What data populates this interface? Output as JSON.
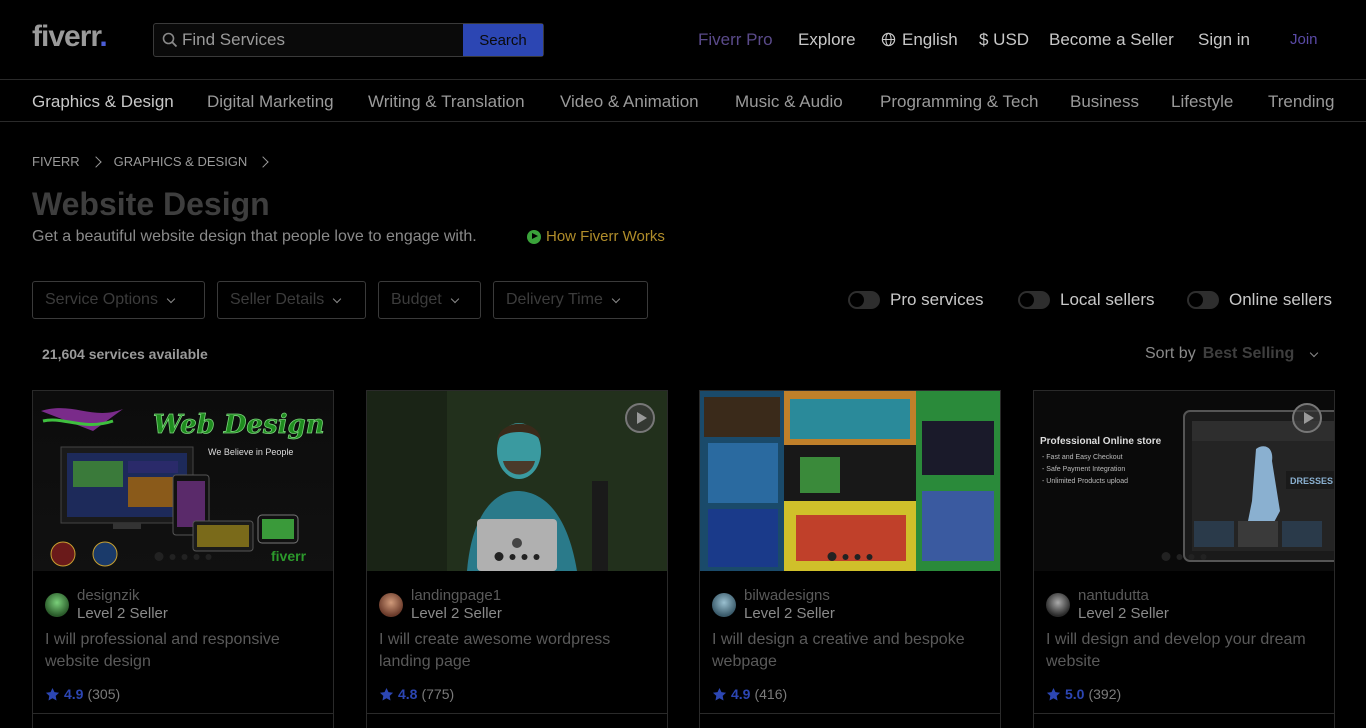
{
  "header": {
    "logo_text": "fiverr",
    "logo_dot": ".",
    "search_placeholder": "Find Services",
    "search_button": "Search",
    "nav": {
      "pro": "Fiverr Pro",
      "explore": "Explore",
      "language": "English",
      "currency": "$ USD",
      "become_seller": "Become a Seller",
      "sign_in": "Sign in",
      "join": "Join"
    }
  },
  "categories": [
    {
      "label": "Graphics & Design",
      "active": true
    },
    {
      "label": "Digital Marketing"
    },
    {
      "label": "Writing & Translation"
    },
    {
      "label": "Video & Animation"
    },
    {
      "label": "Music & Audio"
    },
    {
      "label": "Programming & Tech"
    },
    {
      "label": "Business"
    },
    {
      "label": "Lifestyle"
    },
    {
      "label": "Trending"
    }
  ],
  "breadcrumb": [
    "FIVERR",
    "GRAPHICS & DESIGN"
  ],
  "page": {
    "title": "Website Design",
    "subtitle": "Get a beautiful website design that people love to engage with.",
    "how_link": "How Fiverr Works"
  },
  "filters": [
    "Service Options",
    "Seller Details",
    "Budget",
    "Delivery Time"
  ],
  "toggles": [
    "Pro services",
    "Local sellers",
    "Online sellers"
  ],
  "results": {
    "count": "21,604 services available",
    "sort_label": "Sort by",
    "sort_value": "Best Selling"
  },
  "gigs": [
    {
      "seller": "designzik",
      "level": "Level 2 Seller",
      "title": "I will professional and responsive website design",
      "score": "4.9",
      "reviews": "(305)"
    },
    {
      "seller": "landingpage1",
      "level": "Level 2 Seller",
      "title": "I will create awesome wordpress landing page",
      "score": "4.8",
      "reviews": "(775)"
    },
    {
      "seller": "bilwadesigns",
      "level": "Level 2 Seller",
      "title": "I will design a creative and bespoke webpage",
      "score": "4.9",
      "reviews": "(416)"
    },
    {
      "seller": "nantudutta",
      "level": "Level 2 Seller",
      "title": "I will design and develop your dream website",
      "score": "5.0",
      "reviews": "(392)"
    }
  ],
  "thumb_text": {
    "gig1_heading": "Web Design",
    "gig1_tagline": "We Believe in People",
    "gig1_brand": "fiverr",
    "gig4_heading": "Professional Online store",
    "gig4_points": [
      "- Fast and Easy Checkout",
      "- Safe Payment Integration",
      "- Unlimited Products upload"
    ],
    "gig4_banner": "DRESSES"
  },
  "colors": {
    "accent": "#2c46b3",
    "background": "#000000",
    "link": "#b08d2a",
    "star": "#2c46b3"
  }
}
